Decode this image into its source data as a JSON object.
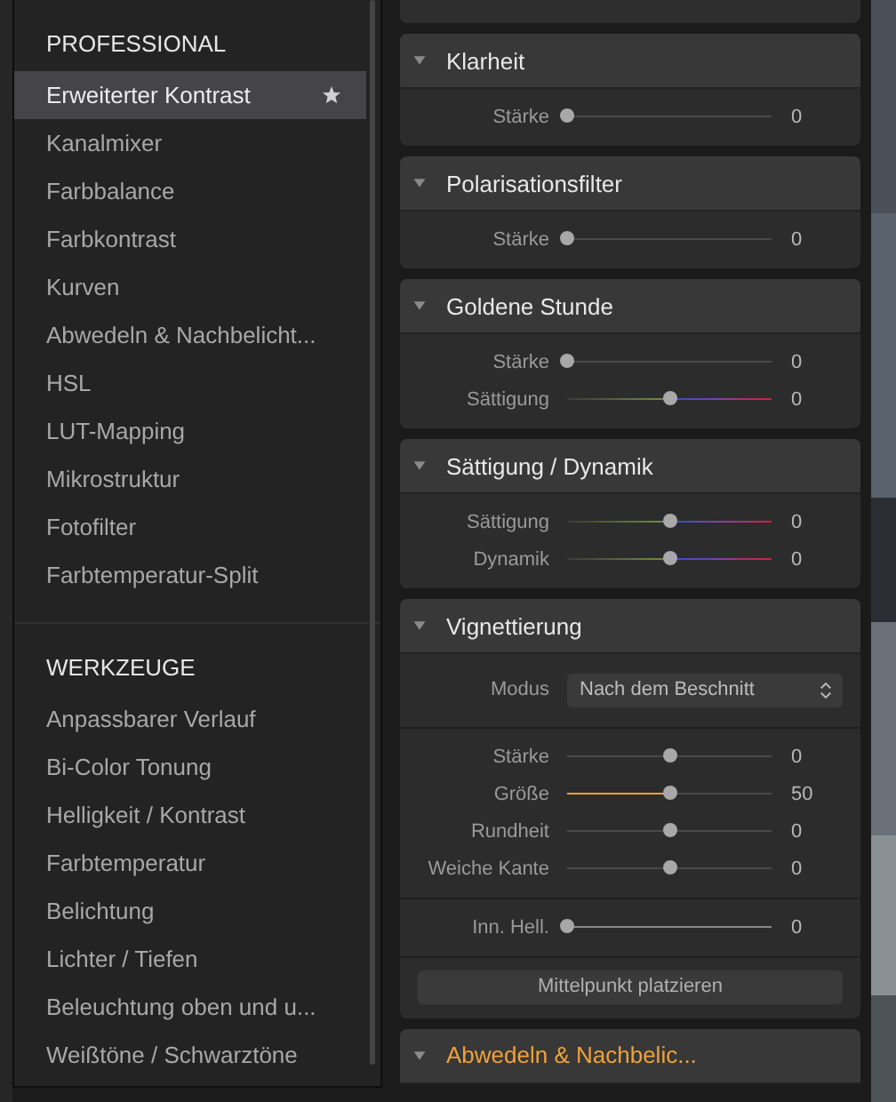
{
  "menu": {
    "groups": [
      {
        "title": "PROFESSIONAL",
        "items": [
          {
            "label": "Erweiterter Kontrast",
            "selected": true,
            "favorite": true
          },
          {
            "label": "Kanalmixer",
            "selected": false,
            "favorite": false
          },
          {
            "label": "Farbbalance",
            "selected": false,
            "favorite": false
          },
          {
            "label": "Farbkontrast",
            "selected": false,
            "favorite": false
          },
          {
            "label": "Kurven",
            "selected": false,
            "favorite": false
          },
          {
            "label": "Abwedeln & Nachbelicht...",
            "selected": false,
            "favorite": false
          },
          {
            "label": "HSL",
            "selected": false,
            "favorite": false
          },
          {
            "label": "LUT-Mapping",
            "selected": false,
            "favorite": false
          },
          {
            "label": "Mikrostruktur",
            "selected": false,
            "favorite": false
          },
          {
            "label": "Fotofilter",
            "selected": false,
            "favorite": false
          },
          {
            "label": "Farbtemperatur-Split",
            "selected": false,
            "favorite": false
          }
        ]
      },
      {
        "title": "WERKZEUGE",
        "items": [
          {
            "label": "Anpassbarer Verlauf",
            "selected": false,
            "favorite": false
          },
          {
            "label": "Bi-Color Tonung",
            "selected": false,
            "favorite": false
          },
          {
            "label": "Helligkeit / Kontrast",
            "selected": false,
            "favorite": false
          },
          {
            "label": "Farbtemperatur",
            "selected": false,
            "favorite": false
          },
          {
            "label": "Belichtung",
            "selected": false,
            "favorite": false
          },
          {
            "label": "Lichter / Tiefen",
            "selected": false,
            "favorite": false
          },
          {
            "label": "Beleuchtung oben und u...",
            "selected": false,
            "favorite": false
          },
          {
            "label": "Weißtöne / Schwarztöne",
            "selected": false,
            "favorite": false
          }
        ]
      }
    ]
  },
  "sections": [
    {
      "title": "Klarheit",
      "expanded": true,
      "highlighted": false,
      "groups": [
        [
          {
            "kind": "slider",
            "label": "Stärke",
            "level": 0,
            "value": "0"
          }
        ]
      ]
    },
    {
      "title": "Polarisationsfilter",
      "expanded": true,
      "highlighted": false,
      "groups": [
        [
          {
            "kind": "slider",
            "label": "Stärke",
            "level": 0,
            "value": "0"
          }
        ]
      ]
    },
    {
      "title": "Goldene Stunde",
      "expanded": true,
      "highlighted": false,
      "groups": [
        [
          {
            "kind": "slider",
            "label": "Stärke",
            "level": 0,
            "value": "0"
          },
          {
            "kind": "spectrum",
            "label": "Sättigung",
            "level": 0.5,
            "value": "0"
          }
        ]
      ]
    },
    {
      "title": "Sättigung / Dynamik",
      "expanded": true,
      "highlighted": false,
      "groups": [
        [
          {
            "kind": "spectrum",
            "label": "Sättigung",
            "level": 0.5,
            "value": "0"
          },
          {
            "kind": "spectrum",
            "label": "Dynamik",
            "level": 0.5,
            "value": "0"
          }
        ]
      ]
    },
    {
      "title": "Vignettierung",
      "expanded": true,
      "highlighted": false,
      "groups": [
        [
          {
            "kind": "select",
            "label": "Modus",
            "value": "Nach dem Beschnitt"
          }
        ],
        [
          {
            "kind": "slider",
            "label": "Stärke",
            "level": 0.5,
            "value": "0"
          },
          {
            "kind": "fill",
            "label": "Größe",
            "level": 0.5,
            "value": "50"
          },
          {
            "kind": "slider",
            "label": "Rundheit",
            "level": 0.5,
            "value": "0"
          },
          {
            "kind": "slider",
            "label": "Weiche Kante",
            "level": 0.5,
            "value": "0"
          }
        ],
        [
          {
            "kind": "bright",
            "label": "Inn. Hell.",
            "level": 0,
            "value": "0"
          }
        ],
        [
          {
            "kind": "button",
            "label": "Mittelpunkt platzieren"
          }
        ]
      ]
    },
    {
      "title": "Abwedeln & Nachbelic...",
      "expanded": true,
      "highlighted": true
    }
  ]
}
